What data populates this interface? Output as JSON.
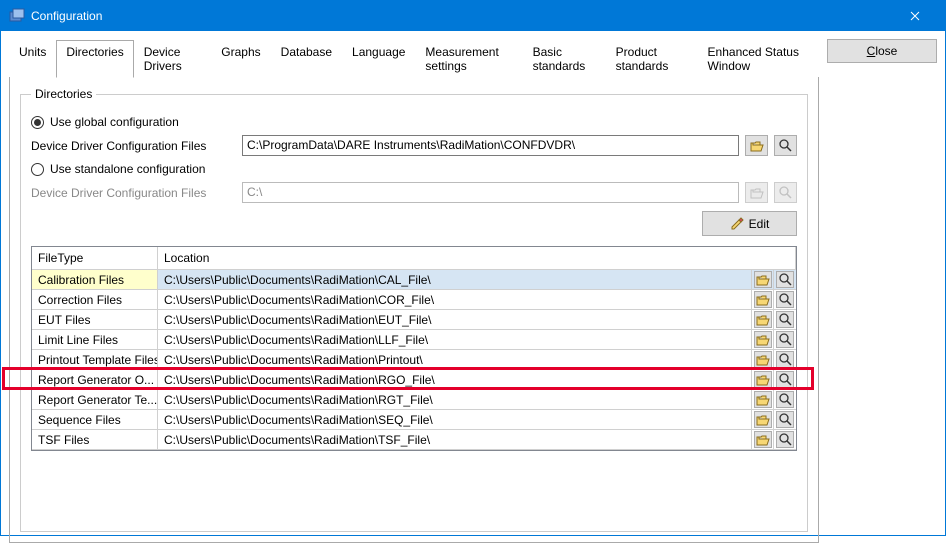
{
  "window": {
    "title": "Configuration"
  },
  "buttons": {
    "close": "Close",
    "close_uchar": "C",
    "close_rest": "lose",
    "edit": "Edit"
  },
  "tabs": {
    "units": "Units",
    "directories": "Directories",
    "device_drivers": "Device Drivers",
    "graphs": "Graphs",
    "database": "Database",
    "language": "Language",
    "measurement": "Measurement settings",
    "basic": "Basic standards",
    "product": "Product standards",
    "enhanced": "Enhanced Status Window"
  },
  "fieldset": {
    "legend": "Directories",
    "global": "Use global configuration",
    "standalone": "Use standalone configuration",
    "driver_label": "Device Driver Configuration Files",
    "path_global": "C:\\ProgramData\\DARE Instruments\\RadiMation\\CONFDVDR\\",
    "path_standalone": "C:\\"
  },
  "table": {
    "headers": {
      "filetype": "FileType",
      "location": "Location"
    },
    "rows": [
      {
        "filetype": "Calibration Files",
        "location": "C:\\Users\\Public\\Documents\\RadiMation\\CAL_File\\"
      },
      {
        "filetype": "Correction Files",
        "location": "C:\\Users\\Public\\Documents\\RadiMation\\COR_File\\"
      },
      {
        "filetype": "EUT Files",
        "location": "C:\\Users\\Public\\Documents\\RadiMation\\EUT_File\\"
      },
      {
        "filetype": "Limit Line Files",
        "location": "C:\\Users\\Public\\Documents\\RadiMation\\LLF_File\\"
      },
      {
        "filetype": "Printout Template Files",
        "location": "C:\\Users\\Public\\Documents\\RadiMation\\Printout\\"
      },
      {
        "filetype": "Report Generator O...",
        "location": "C:\\Users\\Public\\Documents\\RadiMation\\RGO_File\\"
      },
      {
        "filetype": "Report Generator Te...",
        "location": "C:\\Users\\Public\\Documents\\RadiMation\\RGT_File\\"
      },
      {
        "filetype": "Sequence Files",
        "location": "C:\\Users\\Public\\Documents\\RadiMation\\SEQ_File\\"
      },
      {
        "filetype": "TSF Files",
        "location": "C:\\Users\\Public\\Documents\\RadiMation\\TSF_File\\"
      }
    ]
  }
}
